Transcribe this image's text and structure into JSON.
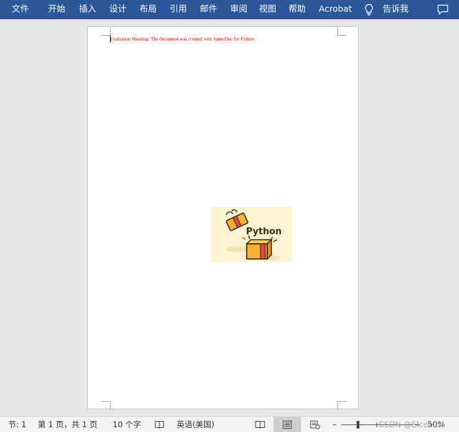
{
  "ribbon": {
    "tabs": [
      {
        "label": "文件"
      },
      {
        "label": "开始"
      },
      {
        "label": "插入"
      },
      {
        "label": "设计"
      },
      {
        "label": "布局"
      },
      {
        "label": "引用"
      },
      {
        "label": "邮件"
      },
      {
        "label": "审阅"
      },
      {
        "label": "视图"
      },
      {
        "label": "帮助"
      },
      {
        "label": "Acrobat"
      }
    ],
    "tell_me": "告诉我",
    "accent_color": "#2b579a"
  },
  "document": {
    "warning_text": "Evaluation Warning: The document was created with Spire.Doc for Python.",
    "warning_color": "#ff0000",
    "image_caption": "Python"
  },
  "status_bar": {
    "section": "节: 1",
    "page_info": "第 1 页，共 1 页",
    "word_count": "10 个字",
    "language": "英语(美国)",
    "zoom_minus": "–",
    "zoom_plus": "+",
    "zoom_level": "50%",
    "watermark": "CSDN @Eiceblue"
  }
}
